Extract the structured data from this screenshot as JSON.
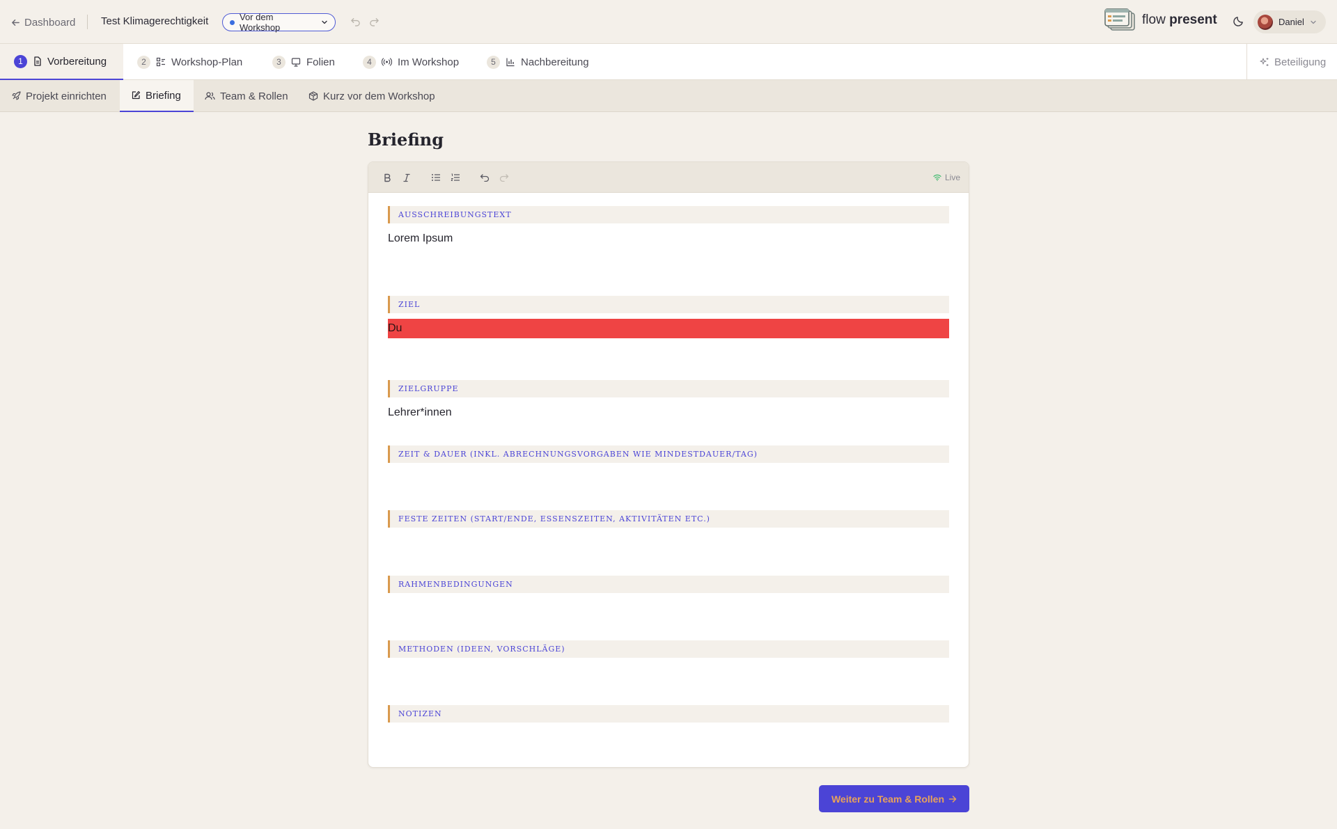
{
  "topbar": {
    "back_label": "Dashboard",
    "project_title": "Test Klimagerechtigkeit",
    "status_label": "Vor dem Workshop",
    "logo_light": "flow",
    "logo_bold": "present",
    "user_name": "Daniel"
  },
  "phases": [
    {
      "num": "1",
      "label": "Vorbereitung",
      "icon": "document-icon"
    },
    {
      "num": "2",
      "label": "Workshop-Plan",
      "icon": "plan-icon"
    },
    {
      "num": "3",
      "label": "Folien",
      "icon": "presentation-icon"
    },
    {
      "num": "4",
      "label": "Im Workshop",
      "icon": "broadcast-icon"
    },
    {
      "num": "5",
      "label": "Nachbereitung",
      "icon": "bar-chart-icon"
    }
  ],
  "beteiligung_label": "Beteiligung",
  "subtabs": [
    {
      "label": "Projekt einrichten",
      "icon": "rocket-icon"
    },
    {
      "label": "Briefing",
      "icon": "edit-icon"
    },
    {
      "label": "Team & Rollen",
      "icon": "users-icon"
    },
    {
      "label": "Kurz vor dem Workshop",
      "icon": "package-icon"
    }
  ],
  "page_title": "Briefing",
  "editor": {
    "live_label": "Live",
    "sections": [
      {
        "label": "Ausschreibungstext",
        "text": "Lorem Ipsum"
      },
      {
        "label": "Ziel",
        "text": "Du"
      },
      {
        "label": "Zielgruppe",
        "text": "Lehrer*innen"
      },
      {
        "label": "Zeit & Dauer (inkl. Abrechnungsvorgaben wie Mindestdauer/Tag)",
        "text": ""
      },
      {
        "label": "Feste Zeiten (Start/Ende, Essenszeiten, Aktivitäten etc.)",
        "text": ""
      },
      {
        "label": "Rahmenbedingungen",
        "text": ""
      },
      {
        "label": "Methoden (Ideen, Vorschläge)",
        "text": ""
      },
      {
        "label": "Notizen",
        "text": ""
      }
    ]
  },
  "next_button_label": "Weiter zu Team & Rollen",
  "colors": {
    "accent": "#4b44d6",
    "highlight": "#ef4444",
    "section_border": "#d99a4e",
    "background": "#f4f0ea"
  }
}
